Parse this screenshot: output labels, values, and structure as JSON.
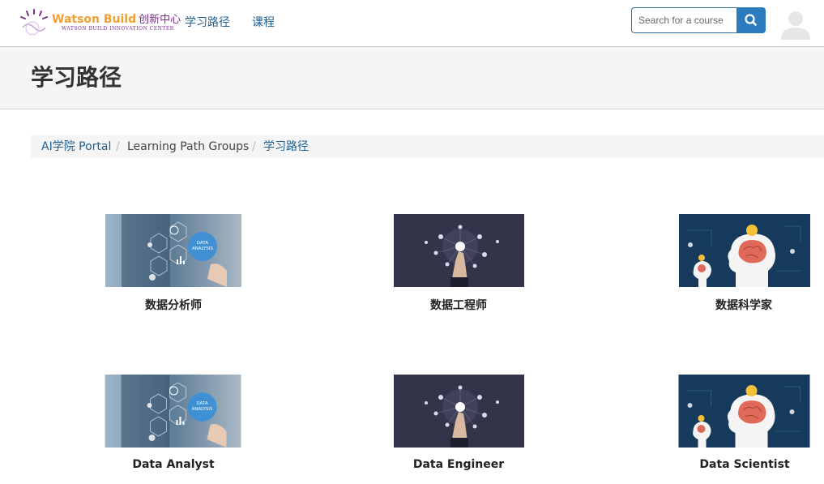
{
  "logo": {
    "brand": "Watson Build",
    "brand_cn": "创新中心",
    "subtitle": "WATSON BUILD INNOVATION CENTER"
  },
  "nav": {
    "learning_paths": "学习路径",
    "courses": "课程"
  },
  "search": {
    "placeholder": "Search for a course",
    "icon": "search-icon"
  },
  "user": {
    "icon": "user-avatar-icon"
  },
  "page": {
    "title": "学习路径"
  },
  "breadcrumb": [
    {
      "label": "AI学院 Portal",
      "link": true
    },
    {
      "label": "Learning Path Groups",
      "link": false
    },
    {
      "label": "学习路径",
      "link": true
    }
  ],
  "breadcrumb_separator": "/",
  "cards": [
    {
      "label": "数据分析师",
      "image": "data-analysis-hand"
    },
    {
      "label": "数据工程师",
      "image": "network-touch"
    },
    {
      "label": "数据科学家",
      "image": "brain-head"
    },
    {
      "label": "Data Analyst",
      "image": "data-analysis-hand"
    },
    {
      "label": "Data Engineer",
      "image": "network-touch"
    },
    {
      "label": "Data Scientist",
      "image": "brain-head"
    }
  ],
  "thumb_text": {
    "data_analysis_line1": "DATA",
    "data_analysis_line2": "ANALYSIS"
  },
  "colors": {
    "link": "#1f5f91",
    "search_button": "#2b7cbf",
    "logo_orange": "#f0a030",
    "logo_purple": "#7a2e8e"
  }
}
